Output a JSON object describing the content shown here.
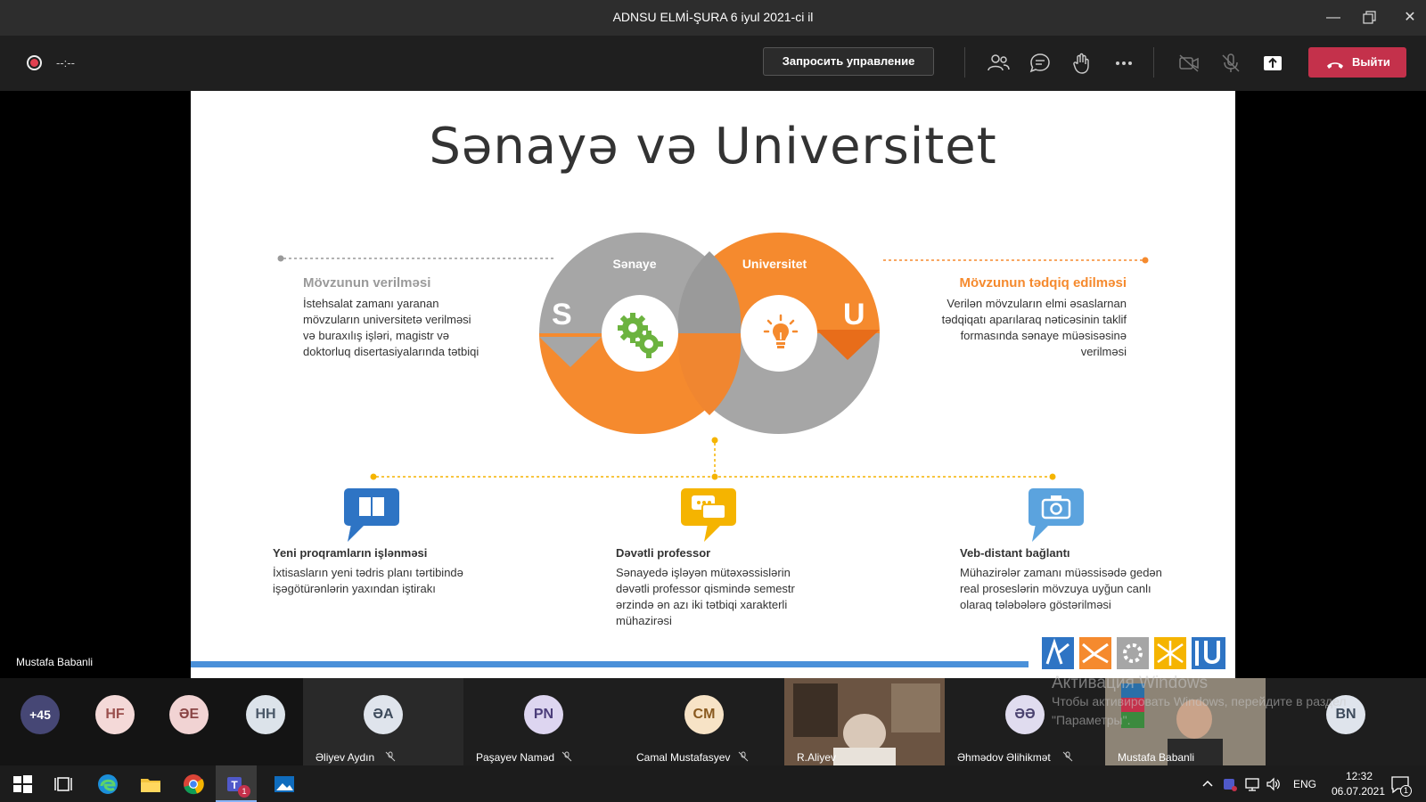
{
  "window": {
    "title": "ADNSU ELMİ-ŞURA 6 iyul 2021-ci il",
    "controls": [
      "minimize-icon",
      "restore-icon",
      "close-icon"
    ]
  },
  "toolbar": {
    "timer": "--:--",
    "request_control": "Запросить управление",
    "icons": [
      "participants-icon",
      "chat-icon",
      "raise-hand-icon",
      "more-icon",
      "camera-off-icon",
      "mic-off-icon",
      "share-tray-icon"
    ],
    "leave_label": "Выйти",
    "leave_color": "#c4314b"
  },
  "stage": {
    "presenter_name": "Mustafa Babanli"
  },
  "slide": {
    "title": "Sənayə və Universitet",
    "left": {
      "heading": "Mövzunun verilməsi",
      "text": "İstehsalat zamanı yaranan mövzuların universitetə verilməsi və buraxılış işləri, magistr və doktorluq disertasiyalarında tətbiqi"
    },
    "right": {
      "heading": "Mövzunun tədqiq edilməsi",
      "text": "Verilən mövzuların elmi əsaslarnan tədqiqatı aparılaraq nəticəsinin taklif formasında sənaye müəsisəsinə verilməsi"
    },
    "diagram": {
      "left_label": "Sənaye",
      "left_letter": "S",
      "right_label": "Universitet",
      "right_letter": "U",
      "left_icon": "gears-icon",
      "right_icon": "lightbulb-icon",
      "colors": {
        "gray": "#a6a6a6",
        "orange": "#f58a2e",
        "dark_orange": "#e86d1a",
        "gear_green": "#6cb33f"
      }
    },
    "features": [
      {
        "title": "Yeni proqramların işlənməsi",
        "text": "İxtisasların yeni tədris planı tərtibində işəgötürənlərin yaxından iştirakı",
        "icon": "book-icon",
        "color": "#2e74c4"
      },
      {
        "title": "Dəvətli professor",
        "text": "Sənayedə işləyən mütəxəssislərin dəvətli professor qismində semestr ərzində ən azı iki tətbiqi xarakterli mühazirəsi",
        "icon": "chat-bubbles-icon",
        "color": "#f5b400"
      },
      {
        "title": "Veb-distant bağlantı",
        "text": "Mühazirələr zamanı müəssisədə gedən  real proseslərin mövzuya uyğun canlı olaraq tələbələrə göstərilməsi",
        "icon": "camera-icon",
        "color": "#5ba3de"
      }
    ],
    "timeline_color": "#f5b400",
    "left_line_color": "#9a9a9a",
    "right_line_color": "#f58a2e",
    "bottom_bar_color": "#4a90d9"
  },
  "participants": {
    "overflow": "+45",
    "tiles": [
      {
        "initials": "HF",
        "bg": "#f4d9d8",
        "fg": "#9a4f4d"
      },
      {
        "initials": "ƏE",
        "bg": "#f1d3d3",
        "fg": "#8a4545"
      },
      {
        "initials": "HH",
        "bg": "#dce3ea",
        "fg": "#4a5868"
      },
      {
        "initials": "ƏA",
        "bg": "#dfe4ec",
        "fg": "#3e4b5c",
        "name": "Əliyev Aydın"
      },
      {
        "initials": "PN",
        "bg": "#ddd5f0",
        "fg": "#4b3d7a",
        "name": "Paşayev Naməd"
      },
      {
        "initials": "CM",
        "bg": "#f7e3c6",
        "fg": "#8a5a1f",
        "name": "Camal Mustafasyev"
      },
      {
        "name": "R.Aliyev"
      },
      {
        "initials": "ƏƏ",
        "bg": "#e0dcef",
        "fg": "#4b4370",
        "name": "Əhmədov Əlihikmət"
      },
      {
        "name": "Mustafa Babanli"
      },
      {
        "initials": "BN",
        "bg": "#dfe4ec",
        "fg": "#3e4b5c"
      }
    ]
  },
  "windows_watermark": {
    "line1": "Активация Windows",
    "line2": "Чтобы активировать Windows, перейдите в раздел",
    "line3": "\"Параметры\"."
  },
  "taskbar": {
    "apps": [
      "windows-start-icon",
      "task-view-icon",
      "edge-icon",
      "file-explorer-icon",
      "chrome-icon",
      "teams-icon",
      "photos-icon"
    ],
    "teams_badge": "1",
    "tray_icons": [
      "chevron-up-icon",
      "teams-tray-icon",
      "network-icon",
      "volume-icon"
    ],
    "language": "ENG",
    "time": "12:32",
    "date": "06.07.2021",
    "notification_count": "1"
  }
}
